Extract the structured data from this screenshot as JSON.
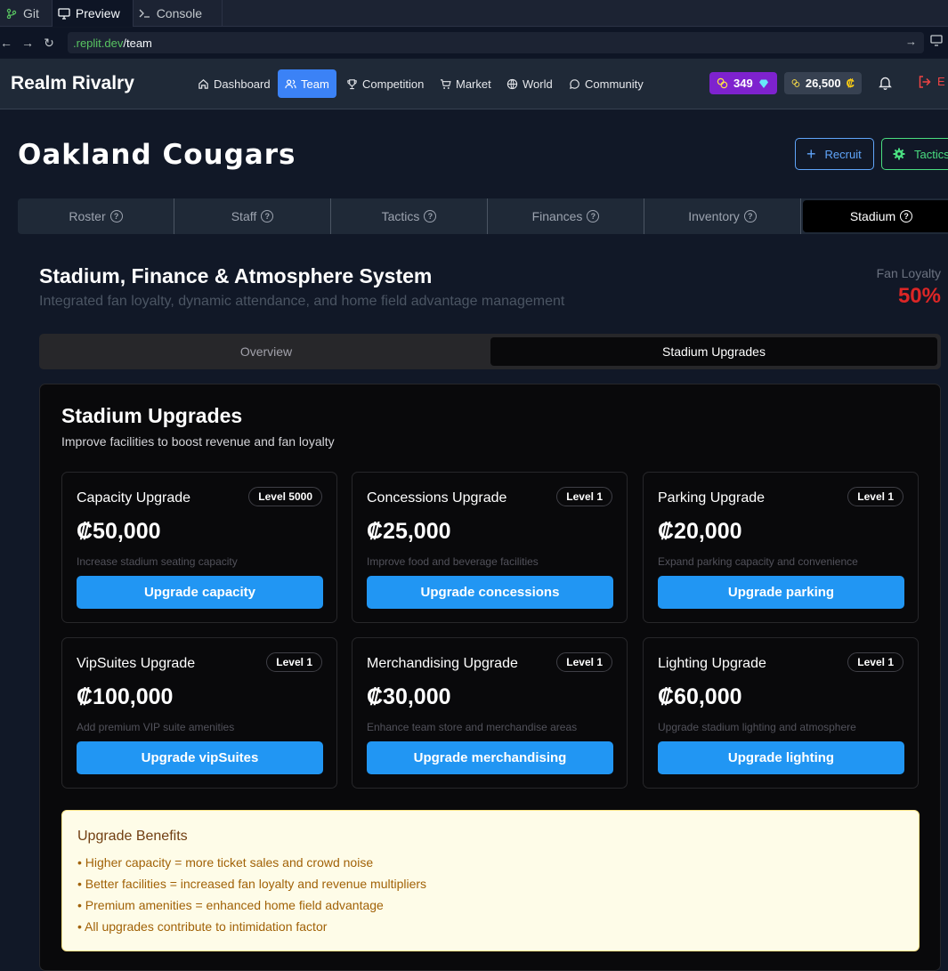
{
  "ide": {
    "tabs": [
      {
        "label": "Git",
        "icon": "git-icon"
      },
      {
        "label": "Preview",
        "icon": "monitor-icon"
      },
      {
        "label": "Console",
        "icon": "terminal-icon"
      }
    ],
    "url_host": ".replit.dev",
    "url_path": "/team"
  },
  "header": {
    "brand": "Realm Rivalry",
    "nav": [
      "Dashboard",
      "Team",
      "Competition",
      "Market",
      "World",
      "Community"
    ],
    "gems": "349",
    "credits": "26,500",
    "credit_symbol": "₡",
    "logout_initial": "E"
  },
  "team": {
    "name": "Oakland Cougars",
    "recruit_label": "Recruit",
    "tactics_label": "Tactics",
    "tabs": [
      "Roster",
      "Staff",
      "Tactics",
      "Finances",
      "Inventory",
      "Stadium"
    ]
  },
  "stadium": {
    "title": "Stadium, Finance & Atmosphere System",
    "subtitle": "Integrated fan loyalty, dynamic attendance, and home field advantage management",
    "fan_loyalty_label": "Fan Loyalty",
    "fan_loyalty_value": "50%",
    "segments": [
      "Overview",
      "Stadium Upgrades"
    ]
  },
  "upgrades": {
    "title": "Stadium Upgrades",
    "subtitle": "Improve facilities to boost revenue and fan loyalty",
    "items": [
      {
        "name": "Capacity Upgrade",
        "level": "Level 5000",
        "cost": "₡50,000",
        "desc": "Increase stadium seating capacity",
        "button": "Upgrade capacity"
      },
      {
        "name": "Concessions Upgrade",
        "level": "Level 1",
        "cost": "₡25,000",
        "desc": "Improve food and beverage facilities",
        "button": "Upgrade concessions"
      },
      {
        "name": "Parking Upgrade",
        "level": "Level 1",
        "cost": "₡20,000",
        "desc": "Expand parking capacity and convenience",
        "button": "Upgrade parking"
      },
      {
        "name": "VipSuites Upgrade",
        "level": "Level 1",
        "cost": "₡100,000",
        "desc": "Add premium VIP suite amenities",
        "button": "Upgrade vipSuites"
      },
      {
        "name": "Merchandising Upgrade",
        "level": "Level 1",
        "cost": "₡30,000",
        "desc": "Enhance team store and merchandise areas",
        "button": "Upgrade merchandising"
      },
      {
        "name": "Lighting Upgrade",
        "level": "Level 1",
        "cost": "₡60,000",
        "desc": "Upgrade stadium lighting and atmosphere",
        "button": "Upgrade lighting"
      }
    ]
  },
  "benefits": {
    "title": "Upgrade Benefits",
    "items": [
      "• Higher capacity = more ticket sales and crowd noise",
      "• Better facilities = increased fan loyalty and revenue multipliers",
      "• Premium amenities = enhanced home field advantage",
      "• All upgrades contribute to intimidation factor"
    ]
  }
}
